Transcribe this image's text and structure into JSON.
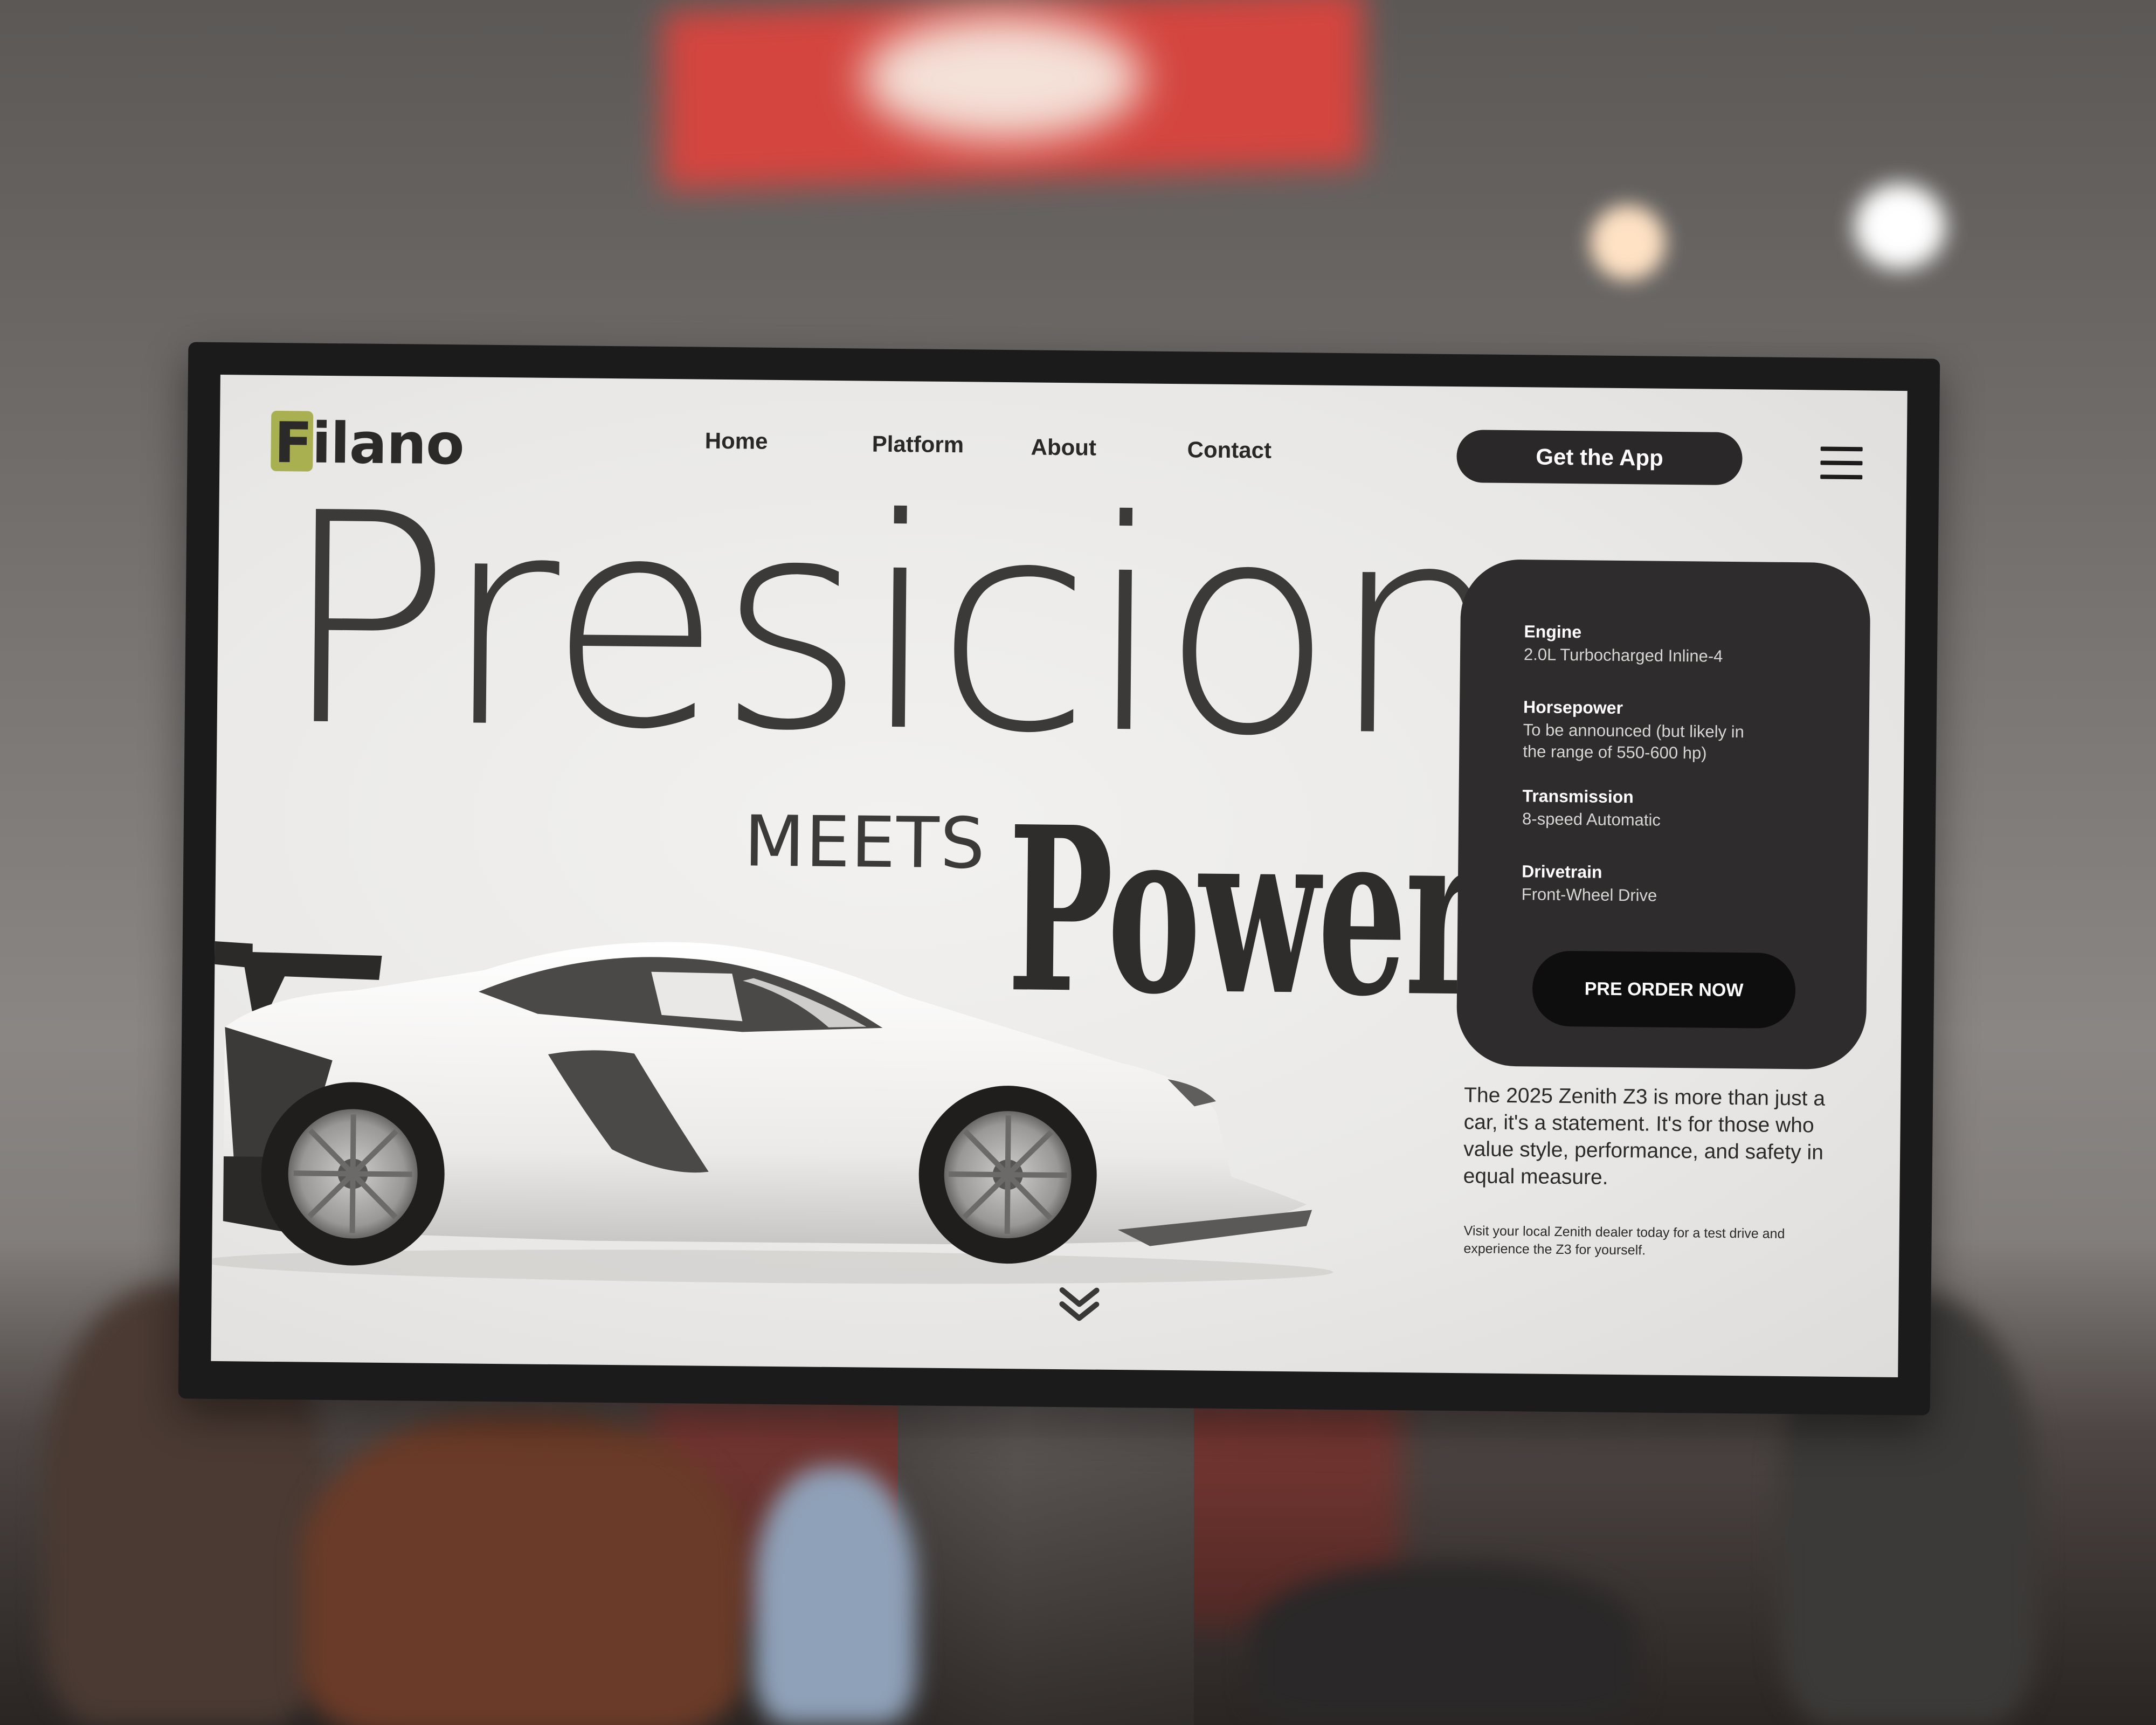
{
  "brand": {
    "name": "Filano",
    "accent_color": "#a8b04f"
  },
  "nav": {
    "items": [
      "Home",
      "Platform",
      "About",
      "Contact"
    ],
    "cta": "Get the App",
    "menu_icon": "hamburger-menu-icon"
  },
  "hero": {
    "line1": "Presicion",
    "line2": "MEETS",
    "line3": "Power"
  },
  "specs": [
    {
      "title": "Engine",
      "value": "2.0L Turbocharged Inline-4"
    },
    {
      "title": "Horsepower",
      "value": "To be announced (but likely in the range of 550-600 hp)"
    },
    {
      "title": "Transmission",
      "value": "8-speed Automatic"
    },
    {
      "title": "Drivetrain",
      "value": "Front-Wheel Drive"
    }
  ],
  "preorder_label": "PRE ORDER NOW",
  "description": "The 2025 Zenith Z3 is more than just a car, it's a statement. It's for those who value style, performance, and safety in equal measure.",
  "note": "Visit your local Zenith dealer today for a test drive and experience the Z3 for yourself.",
  "scroll_icon": "double-chevron-down-icon"
}
